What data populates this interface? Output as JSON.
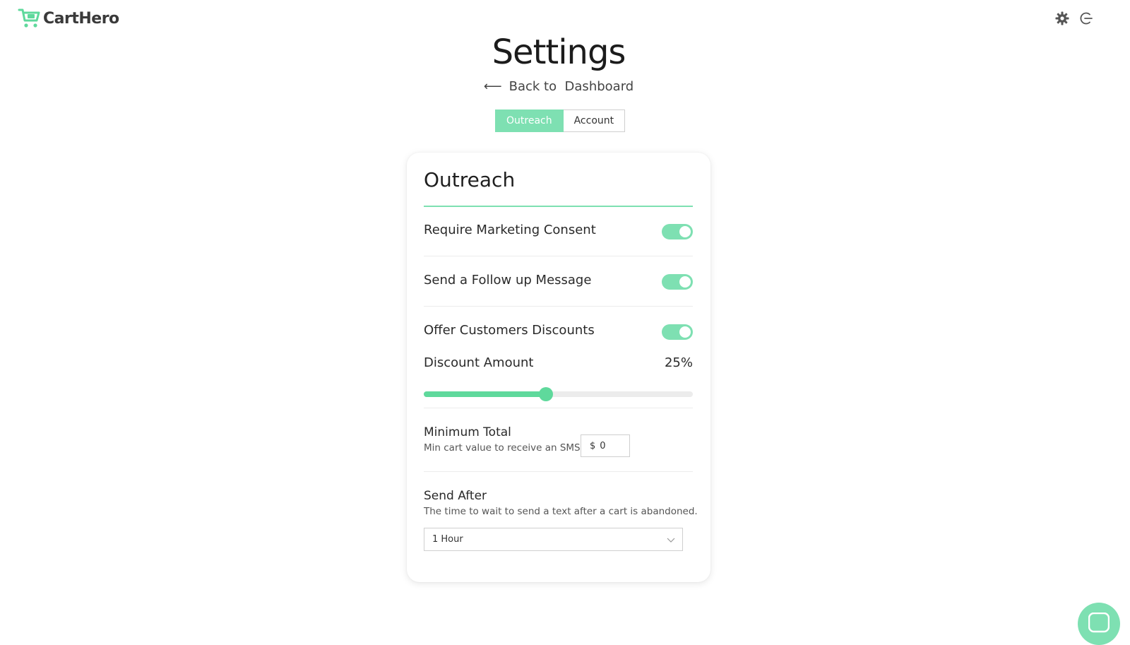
{
  "brand": {
    "name": "CartHero",
    "accent": "#7ee0b2",
    "slider_color": "#5fd99c"
  },
  "header": {
    "icons": [
      "gear-icon",
      "logout-icon"
    ]
  },
  "page": {
    "title": "Settings",
    "back_label": "Back to  Dashboard"
  },
  "tabs": [
    {
      "label": "Outreach",
      "active": true
    },
    {
      "label": "Account",
      "active": false
    }
  ],
  "outreach": {
    "title": "Outreach",
    "require_consent": {
      "label": "Require Marketing Consent",
      "enabled": true
    },
    "follow_up": {
      "label": "Send a Follow up Message",
      "enabled": true
    },
    "discounts": {
      "label": "Offer Customers Discounts",
      "enabled": true
    },
    "discount_amount": {
      "label": "Discount Amount",
      "value_text": "25%",
      "value": 25,
      "max": 55
    },
    "minimum_total": {
      "label": "Minimum Total",
      "help": "Min cart value to receive an SMS.",
      "currency": "$",
      "value": "0"
    },
    "send_after": {
      "label": "Send After",
      "help": "The time to wait to send a text after a cart is abandoned.",
      "selected": "1 Hour"
    }
  },
  "chat": {
    "icon": "chat-icon"
  }
}
